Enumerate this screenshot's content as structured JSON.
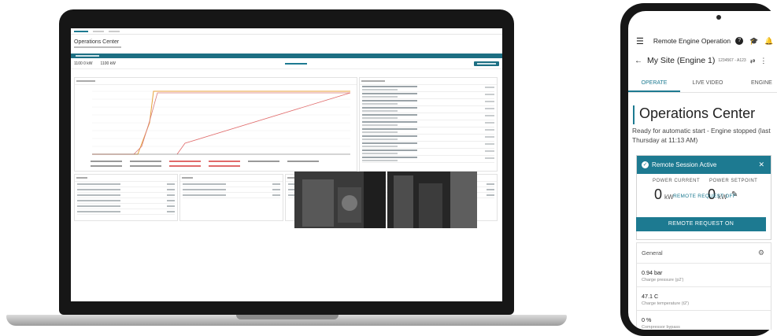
{
  "laptop": {
    "app_title": "Operations Center",
    "power_current": "1100 0 kW",
    "power_setpoint": "1100 kW",
    "chart_legend": [
      "series-a",
      "series-b",
      "series-c",
      "series-d",
      "series-e",
      "series-f",
      "series-g",
      "series-h",
      "series-i",
      "series-j"
    ]
  },
  "phone": {
    "header_title": "Remote Engine Operation",
    "site_name": "My Site (Engine 1)",
    "site_id": "1234567 - A123",
    "tabs": [
      {
        "label": "OPERATE",
        "active": true
      },
      {
        "label": "LIVE VIDEO",
        "active": false
      },
      {
        "label": "ENGINE",
        "active": false
      }
    ],
    "page_title": "Operations Center",
    "status_text": "Ready for automatic start - Engine stopped (last Thursday at 11:13 AM)",
    "remote_session_label": "Remote Session Active",
    "power_current_label": "POWER CURRENT",
    "power_current_value": "0",
    "power_current_unit": "kW",
    "power_setpoint_label": "POWER SETPOINT",
    "power_setpoint_value": "0",
    "power_setpoint_unit": "kW",
    "remote_request_off": "REMOTE REQUEST OFF",
    "remote_request_on": "REMOTE REQUEST ON",
    "general_title": "General",
    "general_rows": [
      {
        "value": "0.94 bar",
        "label": "Charge pressure (p2')"
      },
      {
        "value": "47.1 C",
        "label": "Charge temperature (t2')"
      },
      {
        "value": "0 %",
        "label": "Compressor bypass"
      }
    ]
  },
  "colors": {
    "accent": "#1d7a91",
    "device_frame": "#161616"
  },
  "icons": [
    "menu-icon",
    "help-icon",
    "graduation-cap-icon",
    "bell-icon",
    "back-arrow-icon",
    "swap-icon",
    "more-vert-icon",
    "check-circle-icon",
    "close-icon",
    "pencil-icon",
    "gear-icon"
  ]
}
